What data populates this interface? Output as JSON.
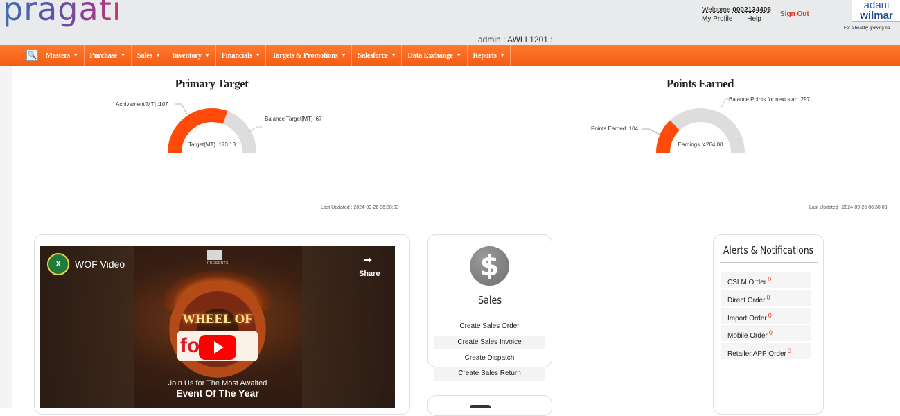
{
  "header": {
    "logo": "pragati",
    "welcome_label": "Welcome",
    "user_id": "0002134406",
    "my_profile": "My Profile",
    "help": "Help",
    "sign_out": "Sign Out",
    "brand_line1": "adani",
    "brand_line2": "wilmar",
    "brand_tagline": "For a healthy growing na",
    "admin_line": "admin : AWLL1201 :"
  },
  "nav": {
    "search_icon": "search-icon",
    "items": [
      "Masters",
      "Purchase",
      "Sales",
      "Inventory",
      "Financials",
      "Targets & Promotions",
      "Salesforce",
      "Data Exchange",
      "Reports"
    ]
  },
  "primary_target": {
    "title": "Primary Target",
    "achievement_label": "Achivement[MT] :107",
    "balance_label": "Balance Target[MT] :67",
    "center_label": "Target(MT) :173.13",
    "last_updated": "Last Updated : 2024-09-26 06:30:03"
  },
  "points_earned": {
    "title": "Points Earned",
    "earned_label": "Points Earned :104",
    "balance_label": "Balance Points for next slab :297",
    "center_label": "Earnings :4264.00",
    "last_updated": "Last Updated : 2024-09-26 06:30:03"
  },
  "chart_data": [
    {
      "type": "pie",
      "title": "Primary Target",
      "categories": [
        "Achivement[MT]",
        "Balance Target[MT]"
      ],
      "values": [
        107,
        67
      ],
      "colors": [
        "#ff4a0a",
        "#dddddd"
      ],
      "center_text": "Target(MT) :173.13"
    },
    {
      "type": "pie",
      "title": "Points Earned",
      "categories": [
        "Points Earned",
        "Balance Points for next slab"
      ],
      "values": [
        104,
        297
      ],
      "colors": [
        "#ff4a0a",
        "#dddddd"
      ],
      "center_text": "Earnings :4264.00"
    }
  ],
  "video": {
    "title": "WOF Video",
    "share": "Share",
    "presents": "PRESENTS",
    "wheel_text": "WHEEL OF",
    "fortune_text": "fo",
    "join_text": "Join Us for The Most Awaited",
    "event_text": "Event Of The Year"
  },
  "sales": {
    "title": "Sales",
    "links": [
      "Create Sales Order",
      "Create Sales Invoice",
      "Create Dispatch",
      "Create Sales Return"
    ]
  },
  "alerts": {
    "title": "Alerts & Notifications",
    "items": [
      {
        "label": "CSLM Order",
        "count": "0"
      },
      {
        "label": "Direct Order",
        "count": "0"
      },
      {
        "label": "Import Order",
        "count": "0"
      },
      {
        "label": "Mobile Order",
        "count": "0"
      },
      {
        "label": "Retailer APP Order",
        "count": "0"
      }
    ]
  },
  "colors": {
    "nav_orange": "#f45c14",
    "gauge_fill": "#ff4a0a",
    "gauge_track": "#dddddd",
    "alert_count": "#e8331c"
  }
}
